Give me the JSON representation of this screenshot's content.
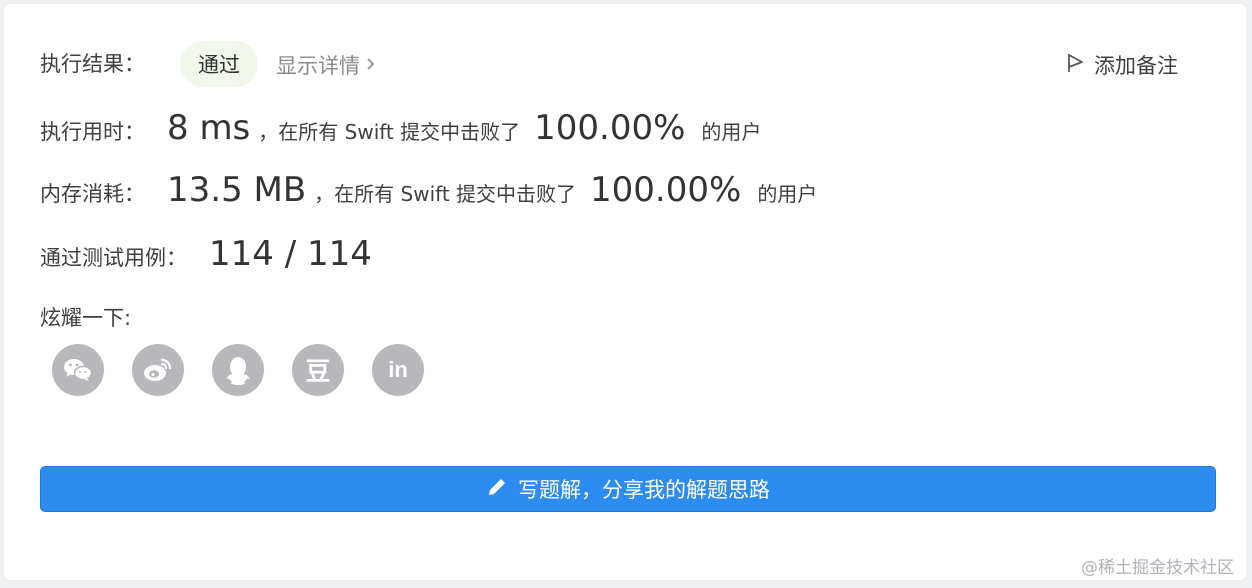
{
  "result": {
    "label": "执行结果：",
    "status": "通过",
    "details_link": "显示详情",
    "add_note": "添加备注"
  },
  "runtime": {
    "label": "执行用时：",
    "value": "8 ms",
    "mid_text": "，在所有 Swift 提交中击败了",
    "percent": "100.00%",
    "suffix": "的用户"
  },
  "memory": {
    "label": "内存消耗：",
    "value": "13.5 MB",
    "mid_text": "，在所有 Swift 提交中击败了",
    "percent": "100.00%",
    "suffix": "的用户"
  },
  "tests": {
    "label": "通过测试用例：",
    "value": "114 / 114"
  },
  "share": {
    "label": "炫耀一下:",
    "icons": [
      "wechat-icon",
      "weibo-icon",
      "qq-icon",
      "douban-icon",
      "linkedin-icon"
    ],
    "douban_glyph": "豆",
    "linkedin_glyph": "in"
  },
  "cta": {
    "label": "写题解，分享我的解题思路",
    "icon": "pencil-icon"
  },
  "watermark": "@稀土掘金技术社区",
  "colors": {
    "primary_button": "#2d8cf0",
    "success_badge_bg": "#f2f7ec",
    "share_icon_bg": "#b8b8bc"
  }
}
